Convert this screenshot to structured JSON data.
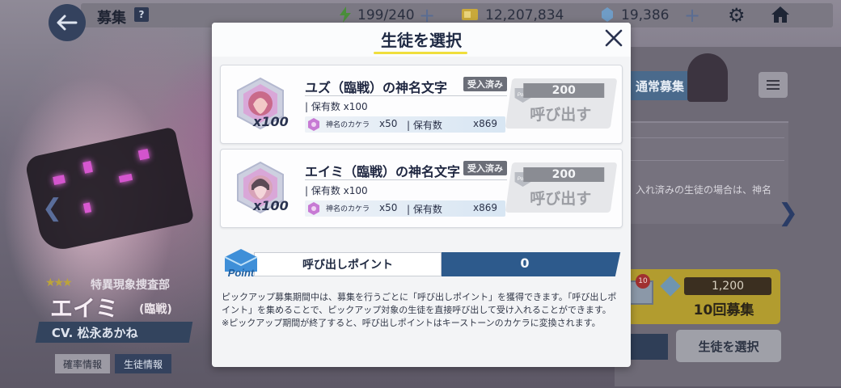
{
  "hud": {
    "title": "募集",
    "help": "?",
    "ap": "199/240",
    "credits": "12,207,834",
    "pyroxene": "19,386",
    "plus": "+"
  },
  "background": {
    "banner_tab": "通常募集",
    "note_text": "入れ済みの生徒の場合は、神名",
    "recruit10": {
      "badge": "10",
      "cost": "1,200",
      "label": "10回募集"
    },
    "select_button": "生徒を選択",
    "character": {
      "stars": "★★★",
      "org": "特異現象捜査部",
      "name": "エイミ",
      "sub": "(臨戦)",
      "cv": "CV. 松永あかね"
    },
    "rate_info": "確率情報",
    "student_info": "生徒情報"
  },
  "modal": {
    "title": "生徒を選択",
    "items": [
      {
        "name": "ユズ（臨戦）の神名文字",
        "badge": "受入済み",
        "qty": "x100",
        "hold": "| 保有数 x100",
        "stat_name": "神名のカケラ",
        "stat_x": "x50",
        "stat_label": "| 保有数",
        "stat_value": "x869",
        "cost": "200",
        "call_label": "呼び出す",
        "point_tag": "Point",
        "hex_color": "#c96a8a"
      },
      {
        "name": "エイミ（臨戦）の神名文字",
        "badge": "受入済み",
        "qty": "x100",
        "hold": "| 保有数 x100",
        "stat_name": "神名のカケラ",
        "stat_x": "x50",
        "stat_label": "| 保有数",
        "stat_value": "x869",
        "cost": "200",
        "call_label": "呼び出す",
        "point_tag": "Point",
        "hex_color": "#d8a3b8"
      }
    ],
    "point_label": "呼び出しポイント",
    "point_value": "0",
    "point_icon": "Point",
    "desc1": "ピックアップ募集期間中は、募集を行うごとに「呼び出しポイント」を獲得できます。「呼び出しポイント」を集めることで、ピックアップ対象の生徒を直接呼び出して受け入れることができます。",
    "desc2": "※ピックアップ期間が終了すると、呼び出しポイントはキーストーンのカケラに変換されます。"
  }
}
